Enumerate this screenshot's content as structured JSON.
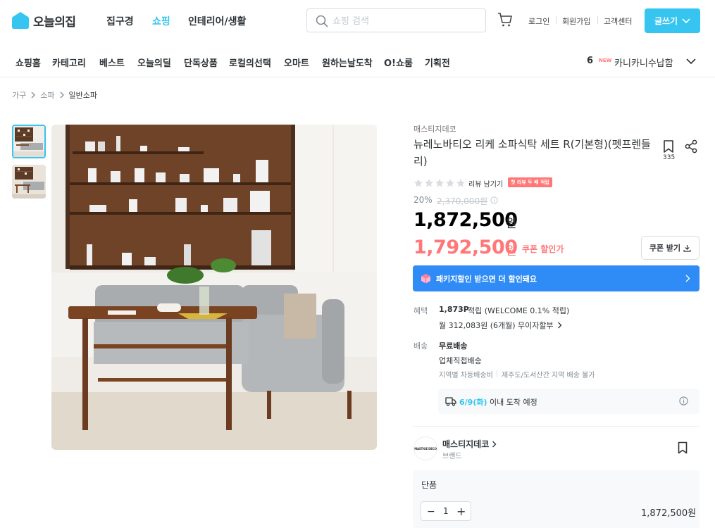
{
  "header": {
    "logo_text": "오늘의집",
    "nav": [
      "집구경",
      "쇼핑",
      "인테리어/생활"
    ],
    "nav_active": "쇼핑",
    "search_placeholder": "쇼핑 검색",
    "user_links": [
      "로그인",
      "회원가입",
      "고객센터"
    ],
    "write_label": "글쓰기",
    "accent_color": "#35c5f0"
  },
  "subnav": {
    "items": [
      "쇼핑홈",
      "카테고리",
      "베스트",
      "오늘의딜",
      "단독상품",
      "로컬의선택",
      "오마트",
      "원하는날도착",
      "O!쇼룸",
      "기획전"
    ],
    "ranking_number": "6",
    "ranking_badge": "NEW",
    "ranking_text": "카니카니수납함"
  },
  "breadcrumb": [
    "가구",
    "소파",
    "일반소파"
  ],
  "product": {
    "brand": "매스티지데코",
    "title": "뉴레노바티오 리케 소파식탁 세트 R(기본형)(펫프렌들리)",
    "bookmark_count": "335",
    "review_link": "리뷰 남기기",
    "review_badge": "첫 리뷰 두 배 적립",
    "rating_stars": 0,
    "discount": "20%",
    "original_price": "2,370,000원",
    "price": "1,872,500",
    "price_unit": "원",
    "coupon_price": "1,792,500",
    "coupon_unit": "원",
    "coupon_label": "쿠폰 할인가",
    "coupon_button": "쿠폰 받기",
    "package_banner": "패키지할인 받으면 더 할인돼요",
    "package_color": "#2f8bf6",
    "coupon_color": "#ff7777"
  },
  "benefit": {
    "label": "혜택",
    "points": "1,873P",
    "points_text": "적립 (WELCOME 0.1% 적립)",
    "installment": "월 312,083원 (6개월) 무이자할부"
  },
  "shipping": {
    "label": "배송",
    "type": "무료배송",
    "method": "업체직접배송",
    "note_1": "지역별 차등배송비",
    "note_2": "제주도/도서산간 지역 배송 불가",
    "eta_date": "6/9(화)",
    "eta_text": "이내 도착 예정"
  },
  "seller": {
    "logo_text": "MASTIGE DECO",
    "name": "매스티지데코",
    "type": "브랜드"
  },
  "option": {
    "name": "단품",
    "quantity": "1",
    "price": "1,872,500원"
  }
}
